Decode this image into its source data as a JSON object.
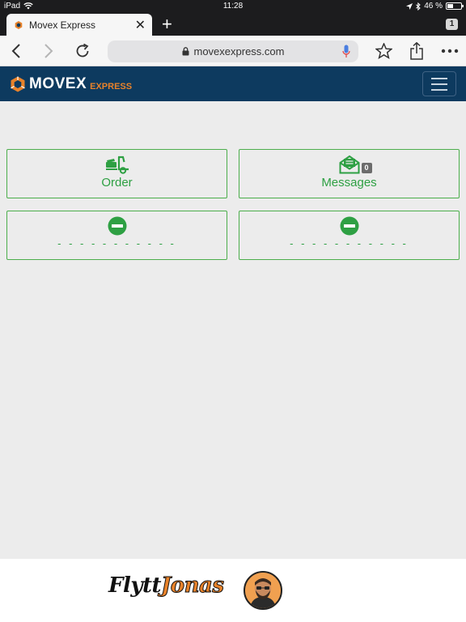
{
  "status_bar": {
    "device": "iPad",
    "time": "11:28",
    "battery": "46 %",
    "battery_level": 0.46
  },
  "browser": {
    "tab_title": "Movex Express",
    "tab_count": "1",
    "url": "movexexpress.com"
  },
  "site": {
    "logo_main": "MOVEX",
    "logo_sub": "EXPRESS",
    "colors": {
      "header": "#0d3a5f",
      "accent": "#e8822a",
      "green": "#2ea043"
    }
  },
  "cards": [
    {
      "label": "Order",
      "icon": "forklift-icon"
    },
    {
      "label": "Messages",
      "icon": "envelope-icon",
      "badge": "0"
    },
    {
      "label": "- - - - - - - - - - -",
      "icon": "no-entry-icon"
    },
    {
      "label": "- - - - - - - - - - -",
      "icon": "no-entry-icon"
    }
  ],
  "footer": {
    "brand_left": "Flytt",
    "brand_right": "Jonas"
  }
}
